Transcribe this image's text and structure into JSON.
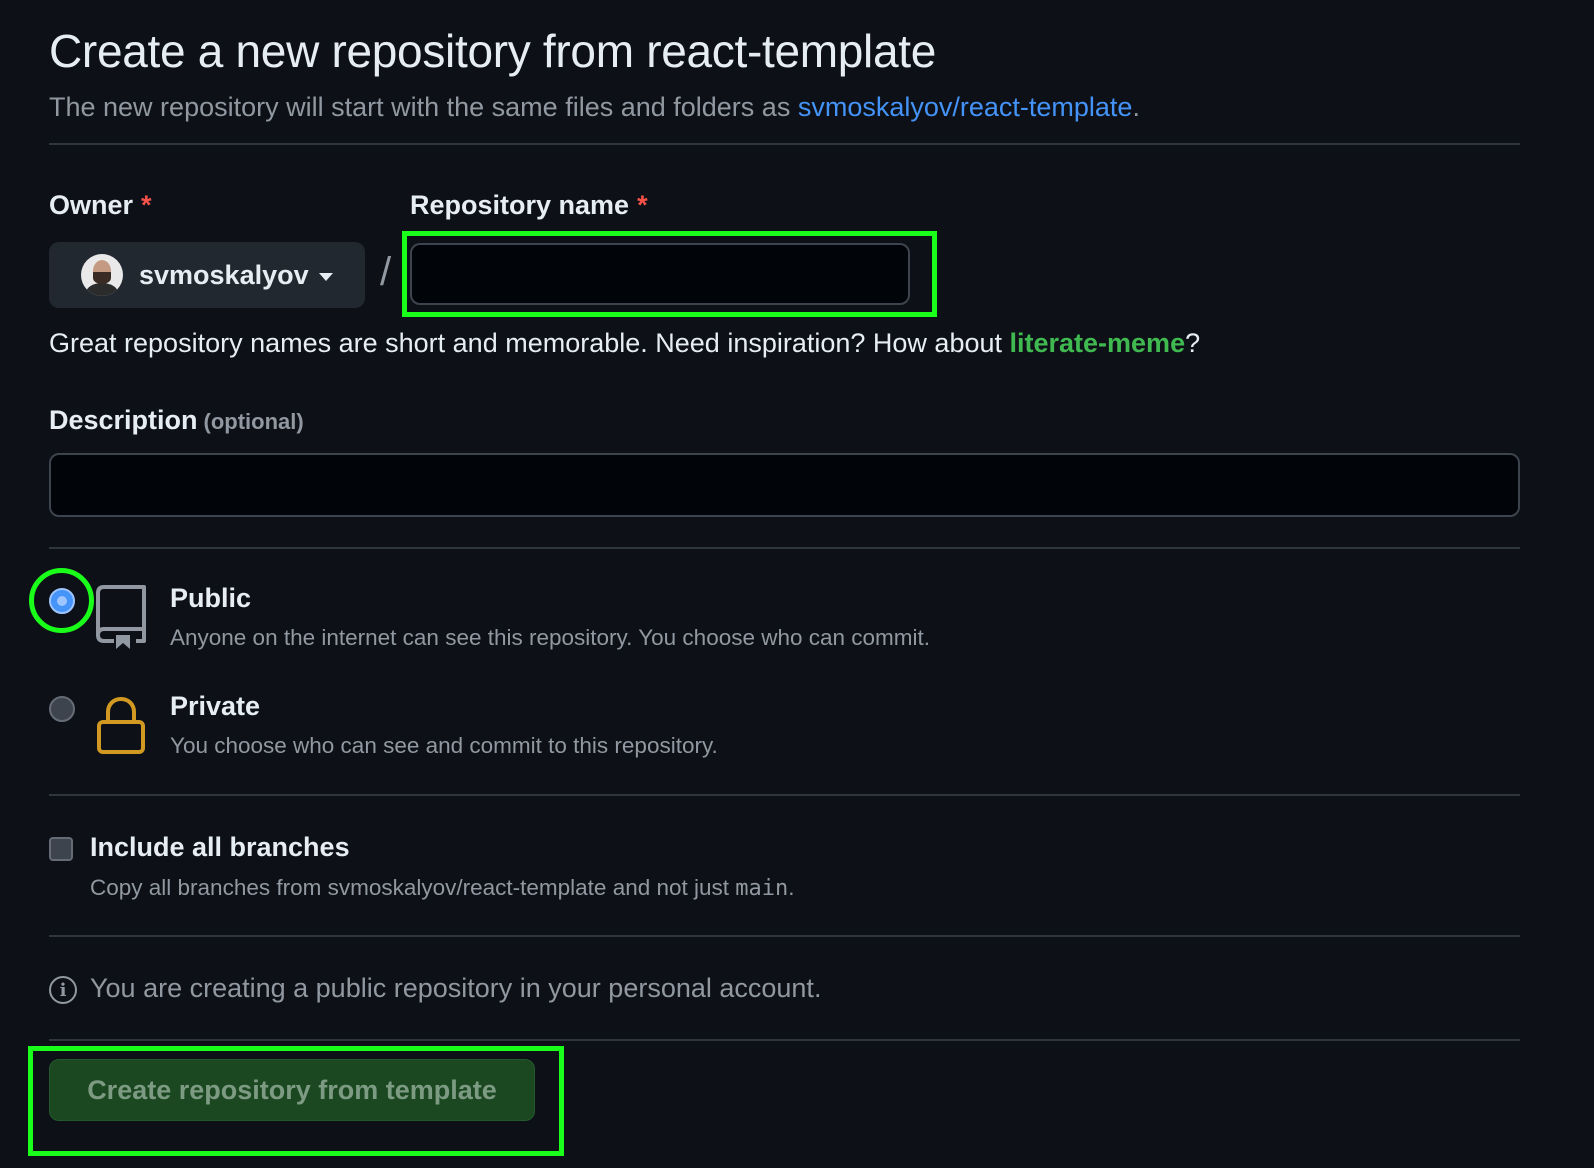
{
  "header": {
    "title": "Create a new repository from react-template",
    "subtitle_prefix": "The new repository will start with the same files and folders as ",
    "template_link": "svmoskalyov/react-template",
    "subtitle_suffix": "."
  },
  "owner": {
    "label": "Owner",
    "required_mark": "*",
    "value": "svmoskalyov"
  },
  "separator": "/",
  "repo_name": {
    "label": "Repository name",
    "required_mark": "*",
    "value": "",
    "placeholder": ""
  },
  "hint": {
    "prefix": "Great repository names are short and memorable. Need inspiration? How about ",
    "suggestion": "literate-meme",
    "suffix": "?"
  },
  "description": {
    "label": "Description",
    "optional": "(optional)",
    "value": "",
    "placeholder": ""
  },
  "visibility": {
    "selected": "public",
    "options": [
      {
        "key": "public",
        "title": "Public",
        "desc": "Anyone on the internet can see this repository. You choose who can commit.",
        "icon": "repo-icon"
      },
      {
        "key": "private",
        "title": "Private",
        "desc": "You choose who can see and commit to this repository.",
        "icon": "lock-icon"
      }
    ]
  },
  "branches": {
    "label": "Include all branches",
    "checked": false,
    "desc_prefix": "Copy all branches from svmoskalyov/react-template and not just ",
    "desc_code": "main",
    "desc_suffix": "."
  },
  "info": {
    "icon": "info-icon",
    "text": "You are creating a public repository in your personal account."
  },
  "submit": {
    "label": "Create repository from template"
  },
  "colors": {
    "background": "#0d1117",
    "link": "#4493f8",
    "suggestion": "#3fb950",
    "required": "#f85149",
    "highlight": "#1aff1a",
    "lock": "#d29922",
    "button_bg": "#1b4721"
  }
}
